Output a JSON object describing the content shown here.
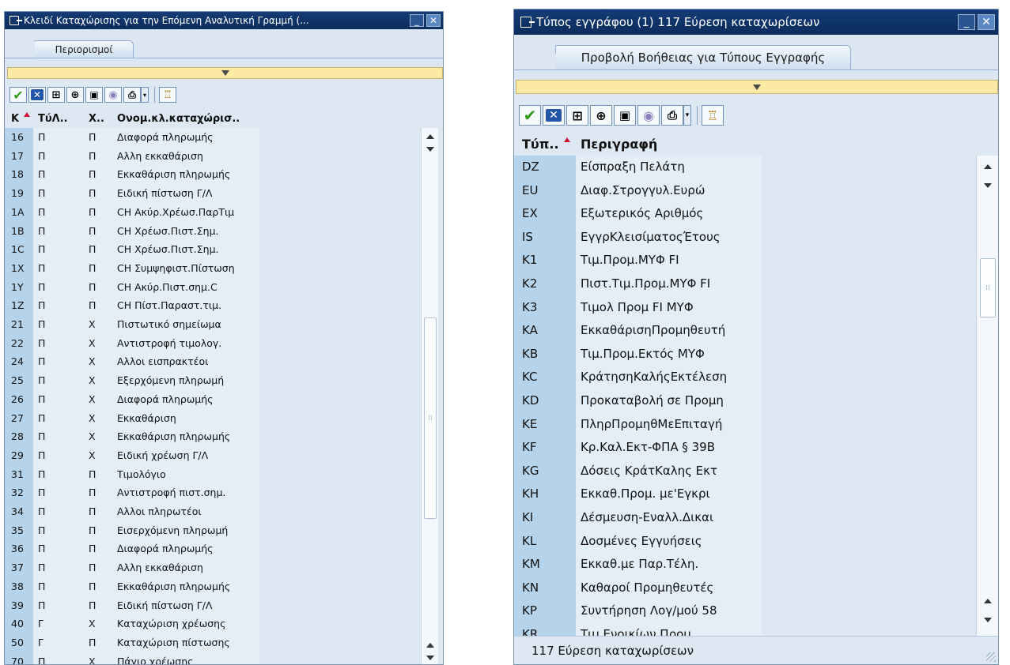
{
  "left_window": {
    "title": "Κλειδί Καταχώρισης για την Επόμενη Αναλυτική Γραμμή (...",
    "tab_label": "Περιορισμοί",
    "headers": [
      "Κ",
      "ΤύΛ..",
      "Χ..",
      "Ονομ.κλ.καταχώρισ.."
    ],
    "rows": [
      [
        "16",
        "Π",
        "Π",
        "Διαφορά πληρωμής"
      ],
      [
        "17",
        "Π",
        "Π",
        "Αλλη εκκαθάριση"
      ],
      [
        "18",
        "Π",
        "Π",
        "Εκκαθάριση πληρωμής"
      ],
      [
        "19",
        "Π",
        "Π",
        "Ειδική πίστωση Γ/Λ"
      ],
      [
        "1A",
        "Π",
        "Π",
        "CH Ακύρ.Χρέωσ.ΠαρΤιμ"
      ],
      [
        "1B",
        "Π",
        "Π",
        "CH Χρέωσ.Πιστ.Σημ."
      ],
      [
        "1C",
        "Π",
        "Π",
        "CH Χρέωσ.Πιστ.Σημ."
      ],
      [
        "1X",
        "Π",
        "Π",
        "CH Συμψηφιστ.Πίστωση"
      ],
      [
        "1Y",
        "Π",
        "Π",
        "CH Ακύρ.Πιστ.σημ.C"
      ],
      [
        "1Z",
        "Π",
        "Π",
        "CH Πίστ.Παραστ.τιμ."
      ],
      [
        "21",
        "Π",
        "X",
        "Πιστωτικό σημείωμα"
      ],
      [
        "22",
        "Π",
        "X",
        "Αντιστροφή τιμολογ."
      ],
      [
        "24",
        "Π",
        "X",
        "Αλλοι εισπρακτέοι"
      ],
      [
        "25",
        "Π",
        "X",
        "Εξερχόμενη πληρωμή"
      ],
      [
        "26",
        "Π",
        "X",
        "Διαφορά πληρωμής"
      ],
      [
        "27",
        "Π",
        "X",
        "Εκκαθάριση"
      ],
      [
        "28",
        "Π",
        "X",
        "Εκκαθάριση πληρωμής"
      ],
      [
        "29",
        "Π",
        "X",
        "Ειδική χρέωση Γ/Λ"
      ],
      [
        "31",
        "Π",
        "Π",
        "Τιμολόγιο"
      ],
      [
        "32",
        "Π",
        "Π",
        "Αντιστροφή πιστ.σημ."
      ],
      [
        "34",
        "Π",
        "Π",
        "Αλλοι πληρωτέοι"
      ],
      [
        "35",
        "Π",
        "Π",
        "Εισερχόμενη πληρωμή"
      ],
      [
        "36",
        "Π",
        "Π",
        "Διαφορά πληρωμής"
      ],
      [
        "37",
        "Π",
        "Π",
        "Αλλη εκκαθάριση"
      ],
      [
        "38",
        "Π",
        "Π",
        "Εκκαθάριση πληρωμής"
      ],
      [
        "39",
        "Π",
        "Π",
        "Ειδική πίστωση Γ/Λ"
      ],
      [
        "40",
        "Γ",
        "X",
        "Καταχώριση χρέωσης"
      ],
      [
        "50",
        "Γ",
        "Π",
        "Καταχώριση πίστωσης"
      ],
      [
        "70",
        "Π",
        "X",
        "Πάγιο χρέωσης"
      ]
    ]
  },
  "right_window": {
    "title": "Τύπος εγγράφου (1)  117 Εύρεση καταχωρίσεων",
    "tab_label": "Προβολή Βοήθειας για Τύπους Εγγραφής",
    "headers": [
      "Τύπ..",
      "Περιγραφή"
    ],
    "rows": [
      [
        "DZ",
        "Είσπραξη Πελάτη"
      ],
      [
        "EU",
        "Διαφ.Στρογγυλ.Ευρώ"
      ],
      [
        "EX",
        "Εξωτερικός Αριθμός"
      ],
      [
        "IS",
        "ΕγγρΚλεισίματοςΈτους"
      ],
      [
        "K1",
        "Τιμ.Προμ.ΜΥΦ FI"
      ],
      [
        "K2",
        "Πιστ.Τιμ.Προμ.ΜΥΦ FI"
      ],
      [
        "K3",
        "Τιμολ Προμ FI ΜΥΦ"
      ],
      [
        "KA",
        "ΕκκαθάρισηΠρομηθευτή"
      ],
      [
        "KB",
        "Τιμ.Προμ.Εκτός ΜΥΦ"
      ],
      [
        "KC",
        "ΚράτησηΚαλήςΕκτέλεση"
      ],
      [
        "KD",
        "Προκαταβολή σε Προμη"
      ],
      [
        "KE",
        "ΠληρΠρομηθΜεΕπιταγή"
      ],
      [
        "KF",
        "Κρ.Καλ.Εκτ-ΦΠΑ § 39Β"
      ],
      [
        "KG",
        "Δόσεις ΚράτΚαλης Εκτ"
      ],
      [
        "KH",
        "Εκκαθ.Προμ. με'Εγκρι"
      ],
      [
        "KI",
        "Δέσμευση-Εναλλ.Δικαι"
      ],
      [
        "KL",
        "Δοσμένες Εγγυήσεις"
      ],
      [
        "KM",
        "Εκκαθ.με Παρ.Τέλη."
      ],
      [
        "KN",
        "Καθαροί Προμηθευτές"
      ],
      [
        "KP",
        "Συντήρηση Λογ/μού 58"
      ],
      [
        "KR",
        "Τιμ.Ενοικίων Προμ"
      ]
    ],
    "status": "117 Εύρεση καταχωρίσεων"
  },
  "icons": [
    "check-icon",
    "cancel-icon",
    "find-icon",
    "find-next-icon",
    "select-icon",
    "info-icon",
    "print-icon",
    "dropdown-icon",
    "wizard-icon"
  ],
  "colors": {
    "titlebar": "#143c75",
    "key_column": "#b5d3ea",
    "data_column": "#e3eef7",
    "yellow_bar": "#fbe9a4",
    "check_green": "#2f9a18"
  }
}
